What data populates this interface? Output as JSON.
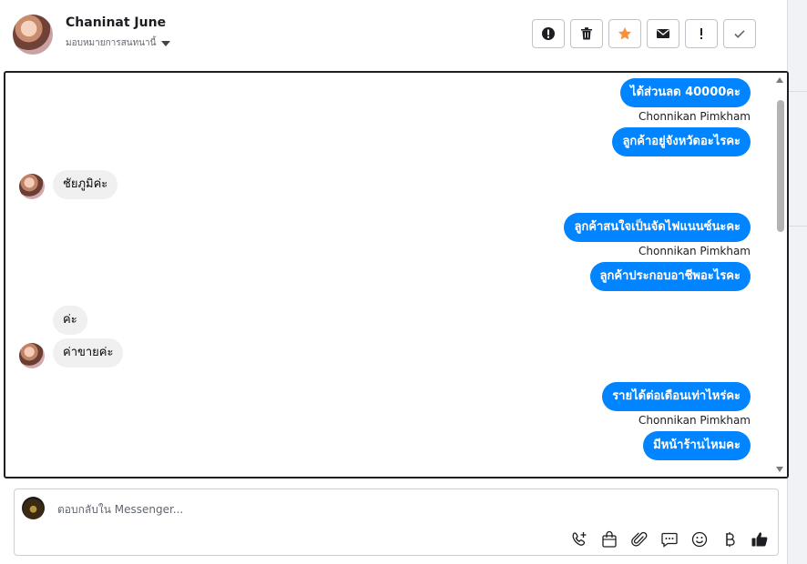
{
  "header": {
    "name": "Chaninat June",
    "assign_label": "มอบหมายการสนทนานี้",
    "actions": [
      "alert-circle-icon",
      "trash-icon",
      "star-icon",
      "envelope-icon",
      "exclamation-icon",
      "checkmark-icon"
    ]
  },
  "messages": [
    {
      "dir": "out",
      "text": "ได้ส่วนลด 40000คะ"
    },
    {
      "dir": "sender",
      "text": "Chonnikan Pimkham"
    },
    {
      "dir": "out",
      "text": "ลูกค้าอยู่จังหวัดอะไรคะ"
    },
    {
      "dir": "in",
      "text": "ชัยภูมิค่ะ"
    },
    {
      "dir": "out",
      "text": "ลูกค้าสนใจเป็นจัดไฟแนนซ์นะคะ"
    },
    {
      "dir": "sender",
      "text": "Chonnikan Pimkham"
    },
    {
      "dir": "out",
      "text": "ลูกค้าประกอบอาชีพอะไรคะ"
    },
    {
      "dir": "in",
      "text": "ค่ะ"
    },
    {
      "dir": "in",
      "text": "ค่าขายค่ะ"
    },
    {
      "dir": "out",
      "text": "รายได้ต่อเดือนเท่าไหร่คะ"
    },
    {
      "dir": "sender",
      "text": "Chonnikan Pimkham"
    },
    {
      "dir": "out",
      "text": "มีหน้าร้านไหมคะ"
    }
  ],
  "composer": {
    "placeholder": "ตอบกลับใน Messenger...",
    "tools": [
      "phone-plus-icon",
      "shopping-bag-icon",
      "paperclip-icon",
      "speech-bubble-icon",
      "smiley-icon",
      "baht-icon",
      "thumbs-up-icon"
    ]
  },
  "colors": {
    "outgoing_bubble": "#0084ff",
    "incoming_bubble": "#f0f0f0",
    "star": "#f7923a"
  }
}
